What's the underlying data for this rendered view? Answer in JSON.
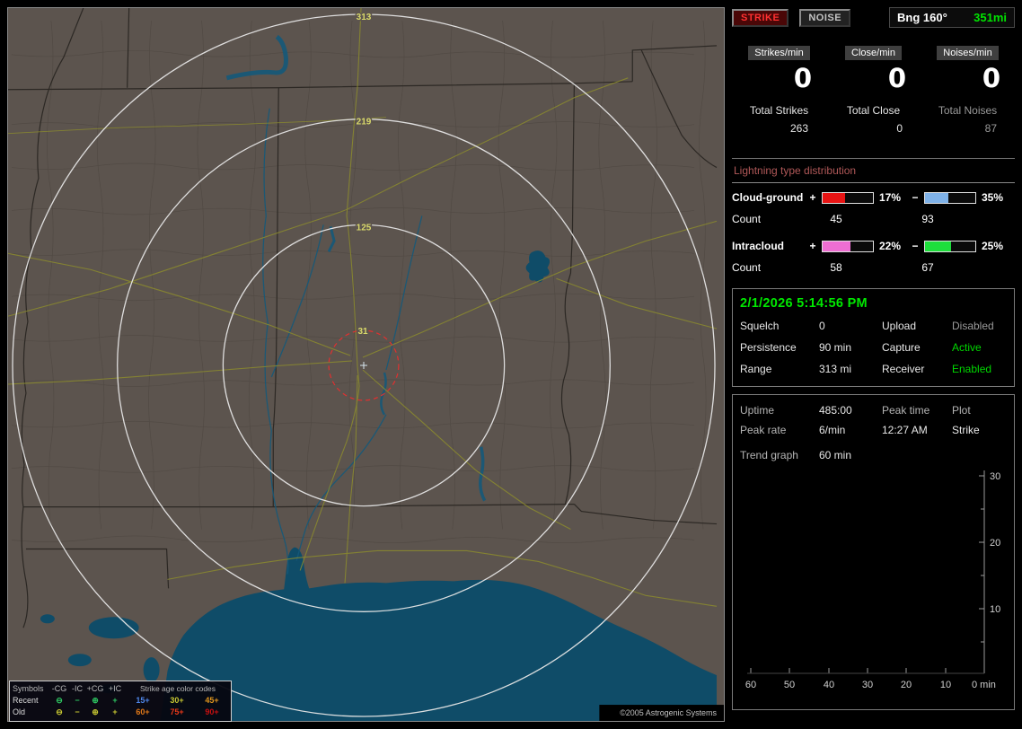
{
  "map": {
    "ring_labels": [
      "313",
      "219",
      "125",
      "31"
    ],
    "copyright": "©2005 Astrogenic Systems",
    "legend": {
      "symbols_header": "Symbols",
      "type_headers": [
        "-CG",
        "-IC",
        "+CG",
        "+IC"
      ],
      "age_header": "Strike age color codes",
      "glyphs": [
        "⊖",
        "−",
        "⊕",
        "+"
      ],
      "rows": [
        {
          "label": "Recent",
          "symbol_style": "color:#2ec862",
          "ages": [
            {
              "text": "15+",
              "style": "color:#4f86e8"
            },
            {
              "text": "30+",
              "style": "color:#c8c832"
            },
            {
              "text": "45+",
              "style": "color:#e0961e"
            }
          ]
        },
        {
          "label": "Old",
          "symbol_style": "color:#c8c832",
          "ages": [
            {
              "text": "60+",
              "style": "color:#e07818"
            },
            {
              "text": "75+",
              "style": "color:#e83818"
            },
            {
              "text": "90+",
              "style": "color:#c81010"
            }
          ]
        }
      ]
    }
  },
  "panel": {
    "strike_button": "STRIKE",
    "noise_button": "NOISE",
    "bearing_label": "Bng 160°",
    "bearing_value": "351mi",
    "counters": [
      {
        "label": "Strikes/min",
        "value": "0"
      },
      {
        "label": "Close/min",
        "value": "0"
      },
      {
        "label": "Noises/min",
        "value": "0"
      }
    ],
    "totals": [
      {
        "label": "Total Strikes",
        "value": "263"
      },
      {
        "label": "Total Close",
        "value": "0"
      },
      {
        "label": "Total Noises",
        "value": "87"
      }
    ],
    "distribution": {
      "title": "Lightning type distribution",
      "rows": [
        {
          "label": "Cloud-ground",
          "plus_sign": "+",
          "plus_pct": "17%",
          "plus_count": "45",
          "plus_fill_style": "width:45%;background:#e81414",
          "minus_sign": "−",
          "minus_pct": "35%",
          "minus_count": "93",
          "minus_fill_style": "width:47%;background:#7fb2e8",
          "count_label": "Count"
        },
        {
          "label": "Intracloud",
          "plus_sign": "+",
          "plus_pct": "22%",
          "plus_count": "58",
          "plus_fill_style": "width:55%;background:#ee6ed2",
          "minus_sign": "−",
          "minus_pct": "25%",
          "minus_count": "67",
          "minus_fill_style": "width:51%;background:#1ede3c",
          "count_label": "Count"
        }
      ]
    },
    "status": {
      "datetime": "2/1/2026 5:14:56 PM",
      "rows": [
        {
          "l1": "Squelch",
          "v1": "0",
          "l2": "Upload",
          "v2": "Disabled",
          "v2_style": "color:#9a9a9a"
        },
        {
          "l1": "Persistence",
          "v1": "90 min",
          "l2": "Capture",
          "v2": "Active",
          "v2_style": "color:#00d800"
        },
        {
          "l1": "Range",
          "v1": "313 mi",
          "l2": "Receiver",
          "v2": "Enabled",
          "v2_style": "color:#00d800"
        }
      ]
    },
    "stats": {
      "row1": {
        "c1": "Uptime",
        "c2": "485:00",
        "c3": "Peak time",
        "c4": "Plot"
      },
      "row2": {
        "c1": "Peak rate",
        "c2": "6/min",
        "c3": "12:27 AM",
        "c4": "Strike"
      },
      "trend_label": "Trend graph",
      "trend_value": "60 min"
    },
    "chart": {
      "y_ticks": [
        "30",
        "20",
        "10"
      ],
      "x_ticks": [
        "60",
        "50",
        "40",
        "30",
        "20",
        "10"
      ],
      "x_end": "0 min"
    }
  }
}
